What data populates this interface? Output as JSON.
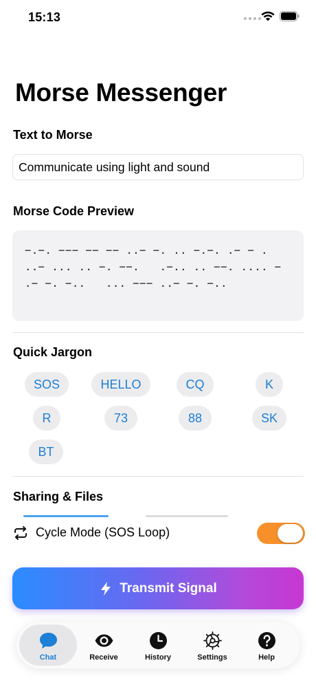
{
  "status_bar": {
    "time": "15:13"
  },
  "app_title": "Morse Messenger",
  "text_to_morse": {
    "title": "Text to Morse",
    "input_value": "Communicate using light and sound"
  },
  "morse_preview": {
    "title": "Morse Code Preview",
    "code": "−.−. −−− −− −− ..− −. .. −.−. .− − .   ..− ... .. −. −−.   .−.. .. −−. .... −   .− −. −..   ... −−− ..− −. −.."
  },
  "quick_jargon": {
    "title": "Quick Jargon",
    "chips": [
      "SOS",
      "HELLO",
      "CQ",
      "K",
      "R",
      "73",
      "88",
      "SK",
      "BT"
    ]
  },
  "sharing": {
    "title": "Sharing & Files"
  },
  "cycle_mode": {
    "label": "Cycle Mode (SOS Loop)",
    "enabled": true
  },
  "transmit": {
    "label": "Transmit Signal",
    "icon": "bolt-icon"
  },
  "tab_bar": {
    "tabs": [
      {
        "label": "Chat",
        "icon": "chat-bubble-icon",
        "active": true
      },
      {
        "label": "Receive",
        "icon": "eye-icon",
        "active": false
      },
      {
        "label": "History",
        "icon": "clock-icon",
        "active": false
      },
      {
        "label": "Settings",
        "icon": "gear-icon",
        "active": false
      },
      {
        "label": "Help",
        "icon": "question-icon",
        "active": false
      }
    ]
  },
  "colors": {
    "accent": "#1d7fd6",
    "toggle_on": "#f7902b",
    "gradient_start": "#2b8cff",
    "gradient_end": "#c737d2"
  }
}
